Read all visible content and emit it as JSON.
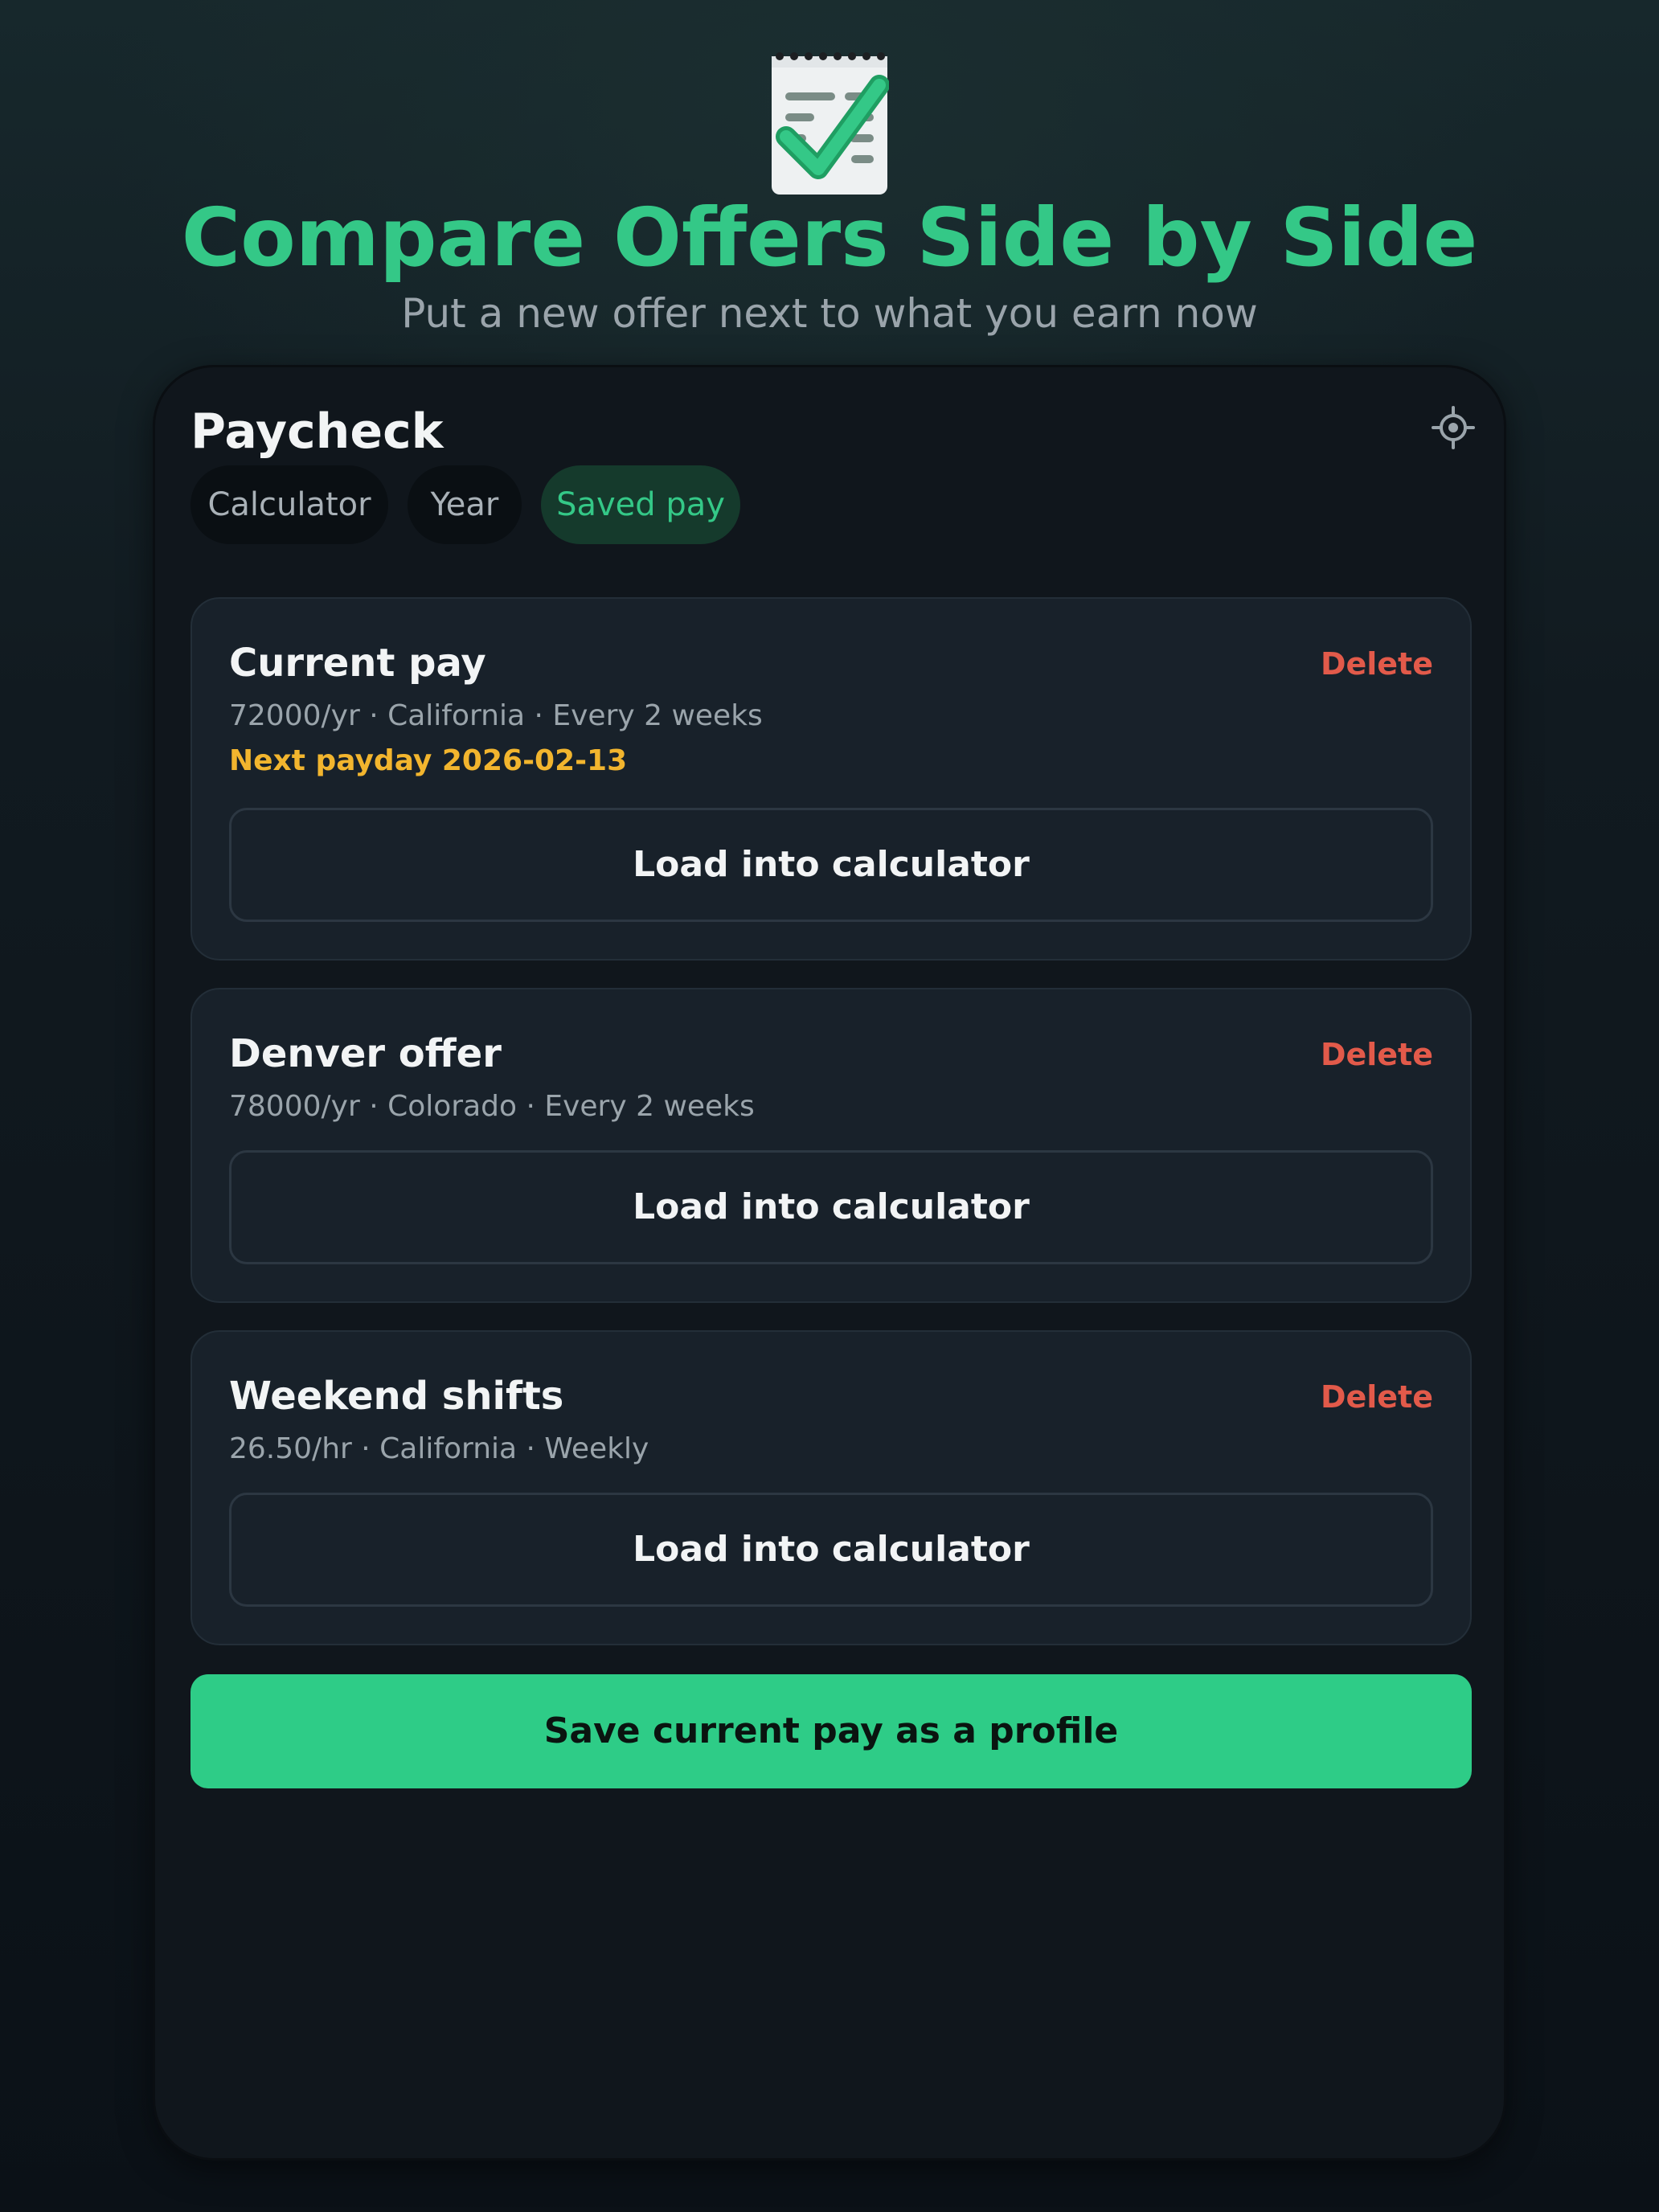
{
  "hero": {
    "icon": "notepad-checkmark-icon",
    "title": "Compare Offers Side by Side",
    "subtitle": "Put a new offer next to what you earn now"
  },
  "panel": {
    "title": "Paycheck",
    "settings_icon": "gear-icon",
    "tabs": [
      {
        "label": "Calculator",
        "active": false
      },
      {
        "label": "Year",
        "active": false
      },
      {
        "label": "Saved pay",
        "active": true
      }
    ]
  },
  "profiles": [
    {
      "name": "Current pay",
      "delete_label": "Delete",
      "meta": "72000/yr · California · Every 2 weeks",
      "next_payday": "Next payday 2026-02-13",
      "load_label": "Load into calculator"
    },
    {
      "name": "Denver offer",
      "delete_label": "Delete",
      "meta": "78000/yr · Colorado · Every 2 weeks",
      "load_label": "Load into calculator"
    },
    {
      "name": "Weekend shifts",
      "delete_label": "Delete",
      "meta": "26.50/hr · California · Weekly",
      "load_label": "Load into calculator"
    }
  ],
  "save_button": {
    "label": "Save current pay as a profile"
  },
  "colors": {
    "accent": "#2ecc87",
    "delete": "#e25a4a",
    "payday": "#f2b52e",
    "panel_bg": "#10161c",
    "card_bg": "#18212a"
  }
}
